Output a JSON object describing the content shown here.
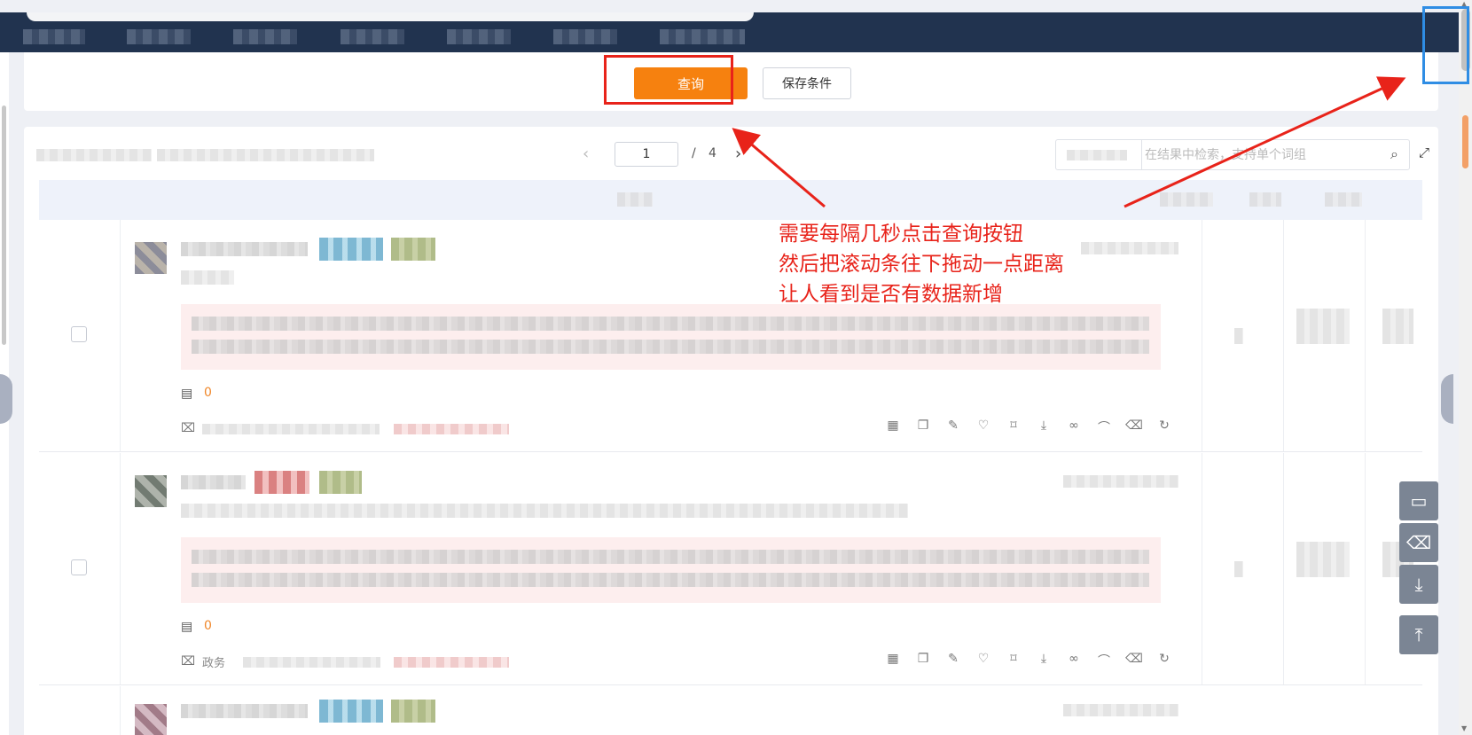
{
  "query_panel": {
    "query_label": "查询",
    "save_label": "保存条件"
  },
  "pager": {
    "current_page": "1",
    "separator": "/",
    "total_pages": "4",
    "prev_icon": "chevron-left-icon",
    "next_icon": "chevron-right-icon"
  },
  "search": {
    "placeholder": "在结果中检索，支持单个词组",
    "search_icon": "search-icon"
  },
  "rows": [
    {
      "count": "0",
      "meta_prefix": ""
    },
    {
      "count": "0",
      "meta_prefix": "政务"
    }
  ],
  "row_actions": [
    "report-icon",
    "copy-icon",
    "edit-icon",
    "heart-icon",
    "tag-icon",
    "download-icon",
    "link-icon",
    "hide-icon",
    "trash-icon",
    "refresh-icon"
  ],
  "float_tools": [
    "comment-icon",
    "trash-icon",
    "download-icon",
    "back-to-top-icon"
  ],
  "annotation": {
    "line1": "需要每隔几秒点击查询按钮",
    "line2": "然后把滚动条往下拖动一点距离",
    "line3": "让人看到是否有数据新增",
    "color": "#e8231a"
  },
  "colors": {
    "nav_bg": "#21334f",
    "query_button": "#f6810f",
    "summary_bg": "#fdeeee",
    "count": "#f0872a",
    "scroll_highlight": "#2f8de4"
  }
}
